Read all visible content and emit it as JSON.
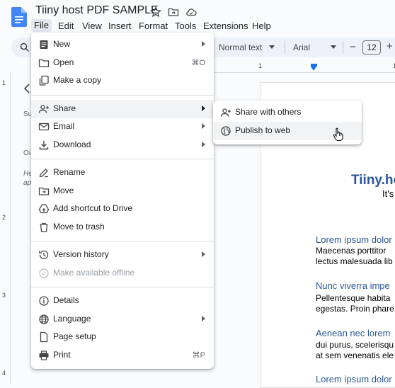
{
  "title": "Tiiny host PDF SAMPLE",
  "menubar": [
    "File",
    "Edit",
    "View",
    "Insert",
    "Format",
    "Tools",
    "Extensions",
    "Help"
  ],
  "toolbar": {
    "style": "Normal text",
    "font": "Arial",
    "font_size": "12",
    "minus": "−",
    "plus": "+"
  },
  "ruler": {
    "h": [
      "1",
      "1"
    ],
    "v": [
      "1",
      "2",
      "3",
      "4"
    ]
  },
  "side_panel_fragments": [
    "Su",
    "Ou",
    "He",
    "ap"
  ],
  "file_menu": {
    "items": [
      {
        "label": "New",
        "submenu": true
      },
      {
        "label": "Open",
        "shortcut": "⌘O"
      },
      {
        "label": "Make a copy"
      },
      {
        "label": "Share",
        "submenu": true
      },
      {
        "label": "Email",
        "submenu": true
      },
      {
        "label": "Download",
        "submenu": true
      },
      {
        "label": "Rename"
      },
      {
        "label": "Move"
      },
      {
        "label": "Add shortcut to Drive"
      },
      {
        "label": "Move to trash"
      },
      {
        "label": "Version history",
        "submenu": true
      },
      {
        "label": "Make available offline",
        "disabled": true
      },
      {
        "label": "Details"
      },
      {
        "label": "Language",
        "submenu": true
      },
      {
        "label": "Page setup"
      },
      {
        "label": "Print",
        "shortcut": "⌘P"
      }
    ]
  },
  "share_menu": {
    "items": [
      {
        "label": "Share with others"
      },
      {
        "label": "Publish to web"
      }
    ]
  },
  "document": {
    "title": "Tiiny.ho",
    "subtitle": "It's",
    "sections": [
      {
        "heading": "Lorem ipsum dolor",
        "lines": [
          "Maecenas porttitor",
          "lectus malesuada lib"
        ]
      },
      {
        "heading": "Nunc viverra impe",
        "lines": [
          "Pellentesque habita",
          "egestas. Proin phare"
        ]
      },
      {
        "heading": "Aenean nec lorem",
        "lines": [
          "dui purus, scelerisqu",
          "at sem venenatis ele"
        ]
      },
      {
        "heading": "Lorem ipsum dolor",
        "lines": []
      }
    ]
  },
  "colors": {
    "accent": "#2b579a",
    "docs_blue": "#4285f4",
    "menu_hover": "#f1f3f4"
  }
}
